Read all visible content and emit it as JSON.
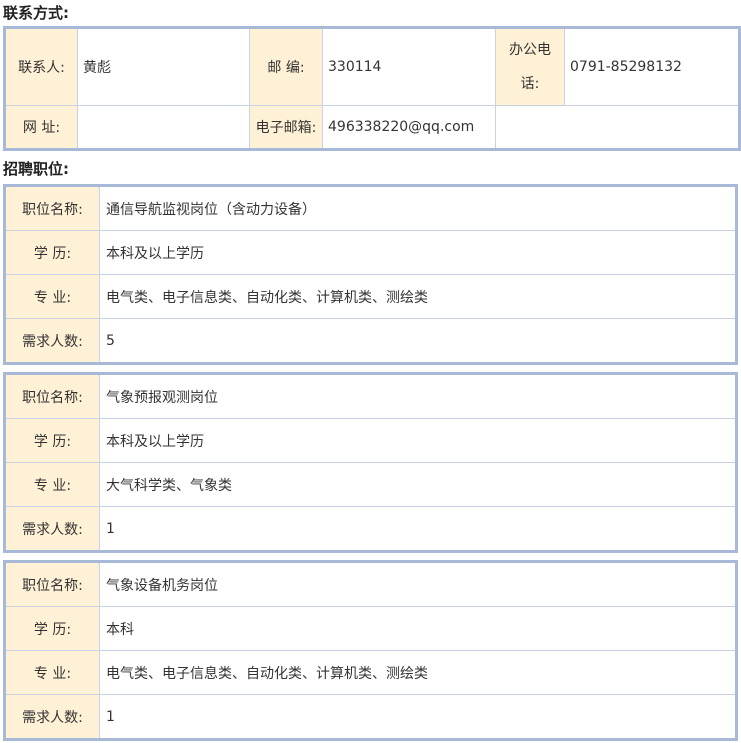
{
  "contact_section": {
    "title": "联系方式:",
    "contact_person_label": "联系人:",
    "contact_person_value": "黄彪",
    "postcode_label": "邮 编:",
    "postcode_value": "330114",
    "office_phone_label_line1": "办公电",
    "office_phone_label_line2": "话:",
    "office_phone_value": "0791-85298132",
    "website_label": "网 址:",
    "website_value": "",
    "email_label": "电子邮箱:",
    "email_value": "496338220@qq.com"
  },
  "jobs_section": {
    "title": "招聘职位:",
    "labels": {
      "name": "职位名称:",
      "education": "学  历:",
      "major": "专  业:",
      "count": "需求人数:"
    },
    "jobs": [
      {
        "name": "通信导航监视岗位（含动力设备）",
        "education": "本科及以上学历",
        "major": "电气类、电子信息类、自动化类、计算机类、测绘类",
        "count": "5"
      },
      {
        "name": "气象预报观测岗位",
        "education": "本科及以上学历",
        "major": "大气科学类、气象类",
        "count": "1"
      },
      {
        "name": "气象设备机务岗位",
        "education": "本科",
        "major": "电气类、电子信息类、自动化类、计算机类、测绘类",
        "count": "1"
      }
    ]
  }
}
